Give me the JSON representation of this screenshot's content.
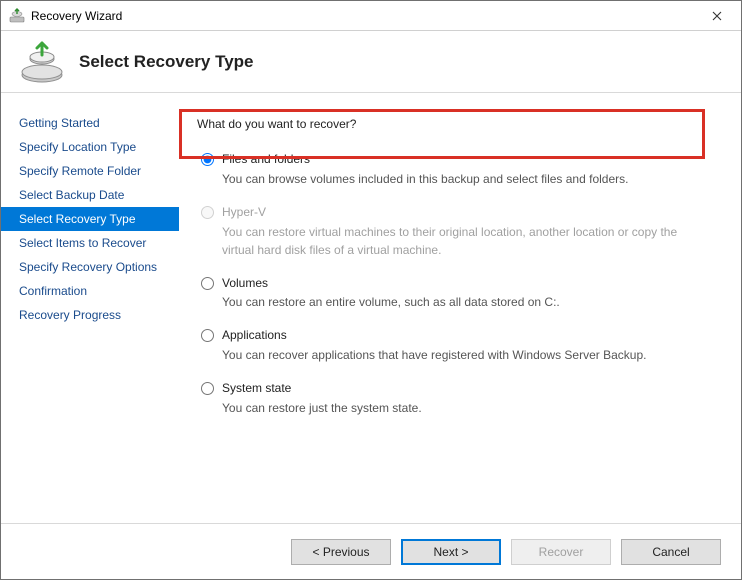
{
  "window": {
    "title": "Recovery Wizard"
  },
  "header": {
    "title": "Select Recovery Type"
  },
  "sidebar": {
    "steps": [
      "Getting Started",
      "Specify Location Type",
      "Specify Remote Folder",
      "Select Backup Date",
      "Select Recovery Type",
      "Select Items to Recover",
      "Specify Recovery Options",
      "Confirmation",
      "Recovery Progress"
    ],
    "active_index": 4
  },
  "content": {
    "prompt": "What do you want to recover?",
    "options": [
      {
        "id": "files",
        "label": "Files and folders",
        "desc": "You can browse volumes included in this backup and select files and folders.",
        "checked": true,
        "disabled": false
      },
      {
        "id": "hyperv",
        "label": "Hyper-V",
        "desc": "You can restore virtual machines to their original location, another location or copy the virtual hard disk files of a virtual machine.",
        "checked": false,
        "disabled": true
      },
      {
        "id": "volumes",
        "label": "Volumes",
        "desc": "You can restore an entire volume, such as all data stored on C:.",
        "checked": false,
        "disabled": false
      },
      {
        "id": "applications",
        "label": "Applications",
        "desc": "You can recover applications that have registered with Windows Server Backup.",
        "checked": false,
        "disabled": false
      },
      {
        "id": "systemstate",
        "label": "System state",
        "desc": "You can restore just the system state.",
        "checked": false,
        "disabled": false
      }
    ]
  },
  "footer": {
    "previous": "< Previous",
    "next": "Next >",
    "recover": "Recover",
    "cancel": "Cancel",
    "recover_disabled": true
  }
}
